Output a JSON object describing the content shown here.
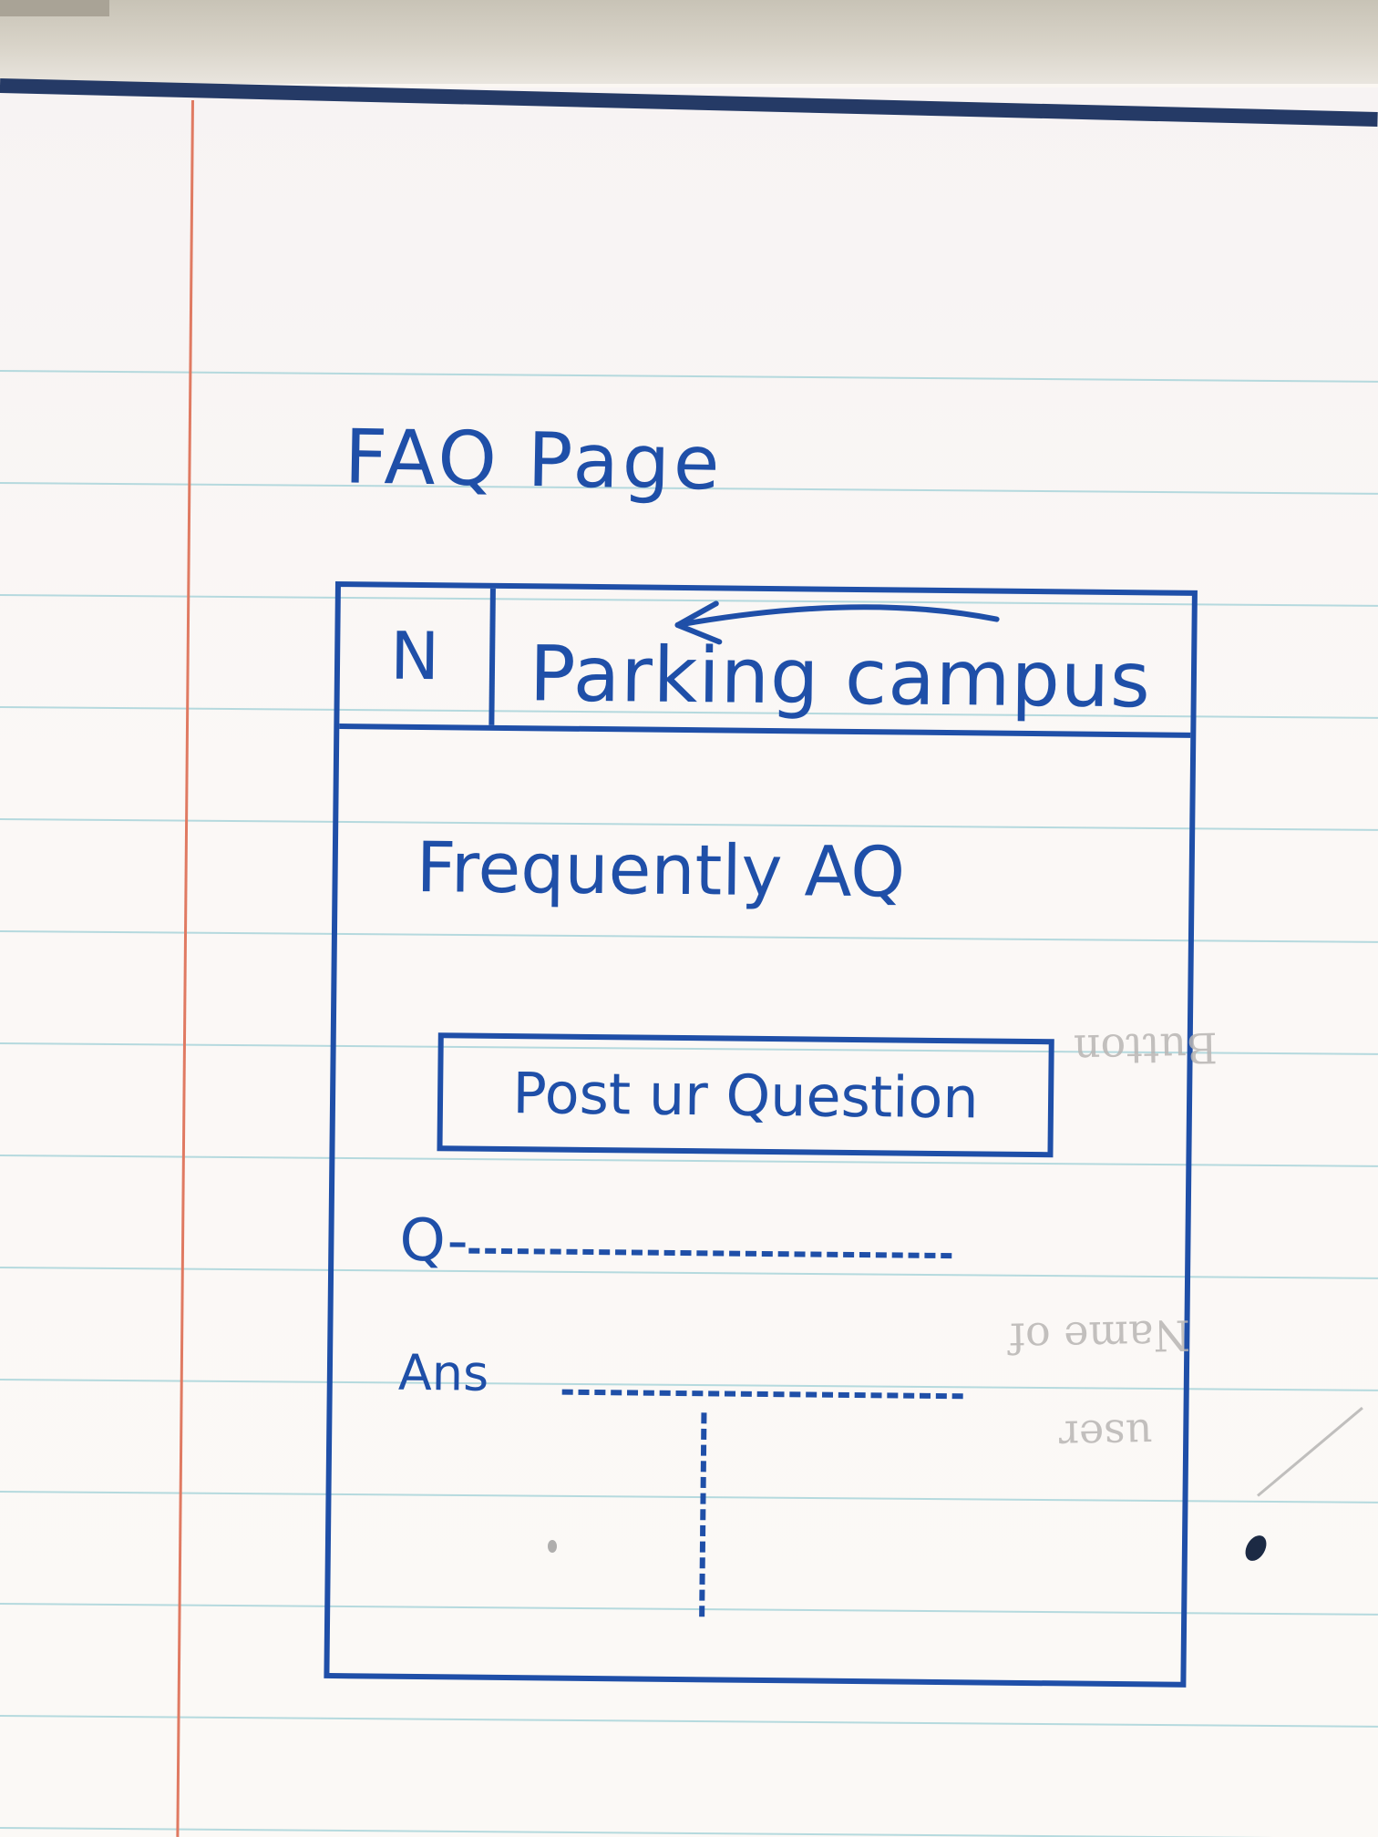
{
  "page": {
    "title": "FAQ Page"
  },
  "navbar": {
    "toggle_label": "N",
    "brand": "Parking campus"
  },
  "main": {
    "heading": "Frequently AQ",
    "post_button_label": "Post ur Question",
    "faq": {
      "question_label": "Q-",
      "answer_label": "Ans"
    }
  },
  "annotations": {
    "note_1": "Button",
    "note_2": "Name of",
    "note_3": "user"
  },
  "colors": {
    "ink": "#1f4fa8",
    "rule": "#9ecfd6",
    "margin": "#e07a62",
    "paper": "#fbf8f6"
  }
}
